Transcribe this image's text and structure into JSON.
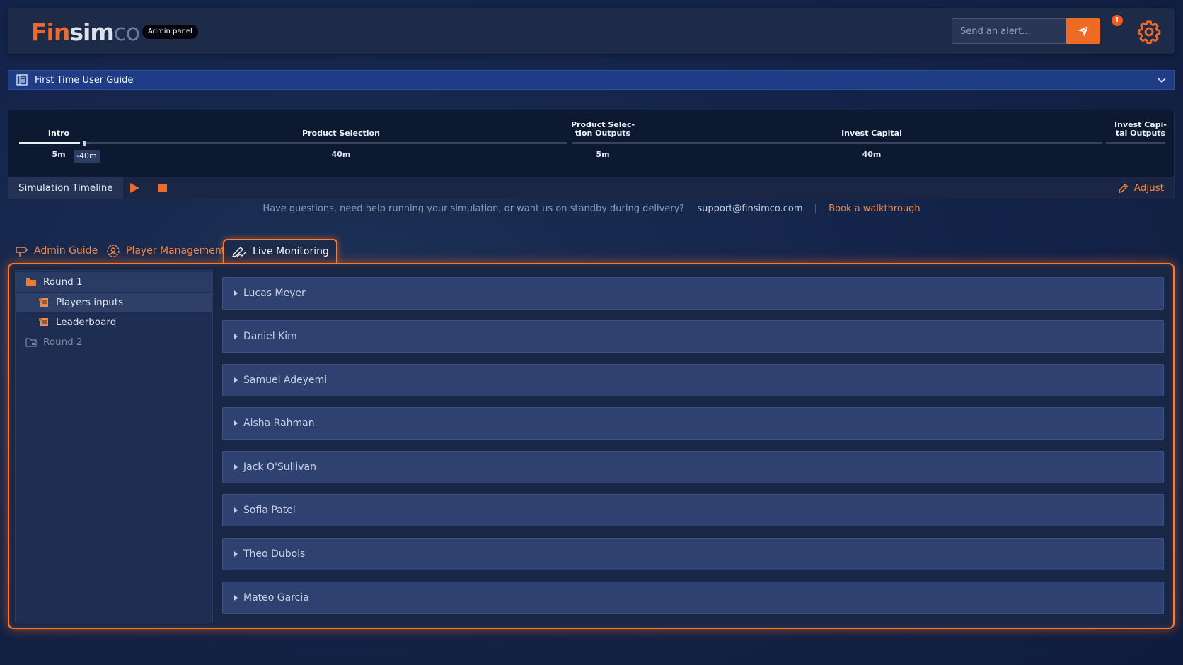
{
  "header": {
    "logo": {
      "part1": "Fin",
      "part2": "sim",
      "part3": "co"
    },
    "badge": "Admin panel",
    "alert_placeholder": "Send an alert...",
    "alert_count": "!",
    "accent": "#ee6a25"
  },
  "guide": {
    "label": "First Time User Guide"
  },
  "timeline": {
    "phases": [
      {
        "name": "Intro",
        "duration": "5m"
      },
      {
        "name": "Product Selection",
        "duration": "40m"
      },
      {
        "name": "Product Selec-\ntion Outputs",
        "duration": "5m"
      },
      {
        "name": "Invest Capital",
        "duration": "40m"
      },
      {
        "name": "Invest Capi-\ntal Outputs",
        "duration": ""
      }
    ],
    "marker": "-40m",
    "control_label": "Simulation Timeline",
    "adjust_label": "Adjust"
  },
  "help": {
    "text": "Have questions, need help running your simulation, or want us on standby during delivery?",
    "email": "support@finsimco.com",
    "separator": "|",
    "link": "Book a walkthrough"
  },
  "tabs": [
    {
      "label": "Admin Guide",
      "icon": "signpost-icon"
    },
    {
      "label": "Player Management",
      "icon": "user-gear-icon"
    },
    {
      "label": "Live Monitoring",
      "icon": "pen-chart-icon",
      "active": true
    }
  ],
  "tree": {
    "round1": "Round 1",
    "items": [
      "Players inputs",
      "Leaderboard"
    ],
    "round2": "Round 2"
  },
  "players": [
    "Lucas Meyer",
    "Daniel Kim",
    "Samuel Adeyemi",
    "Aisha Rahman",
    "Jack O'Sullivan",
    "Sofia Patel",
    "Theo Dubois",
    "Mateo Garcia"
  ]
}
